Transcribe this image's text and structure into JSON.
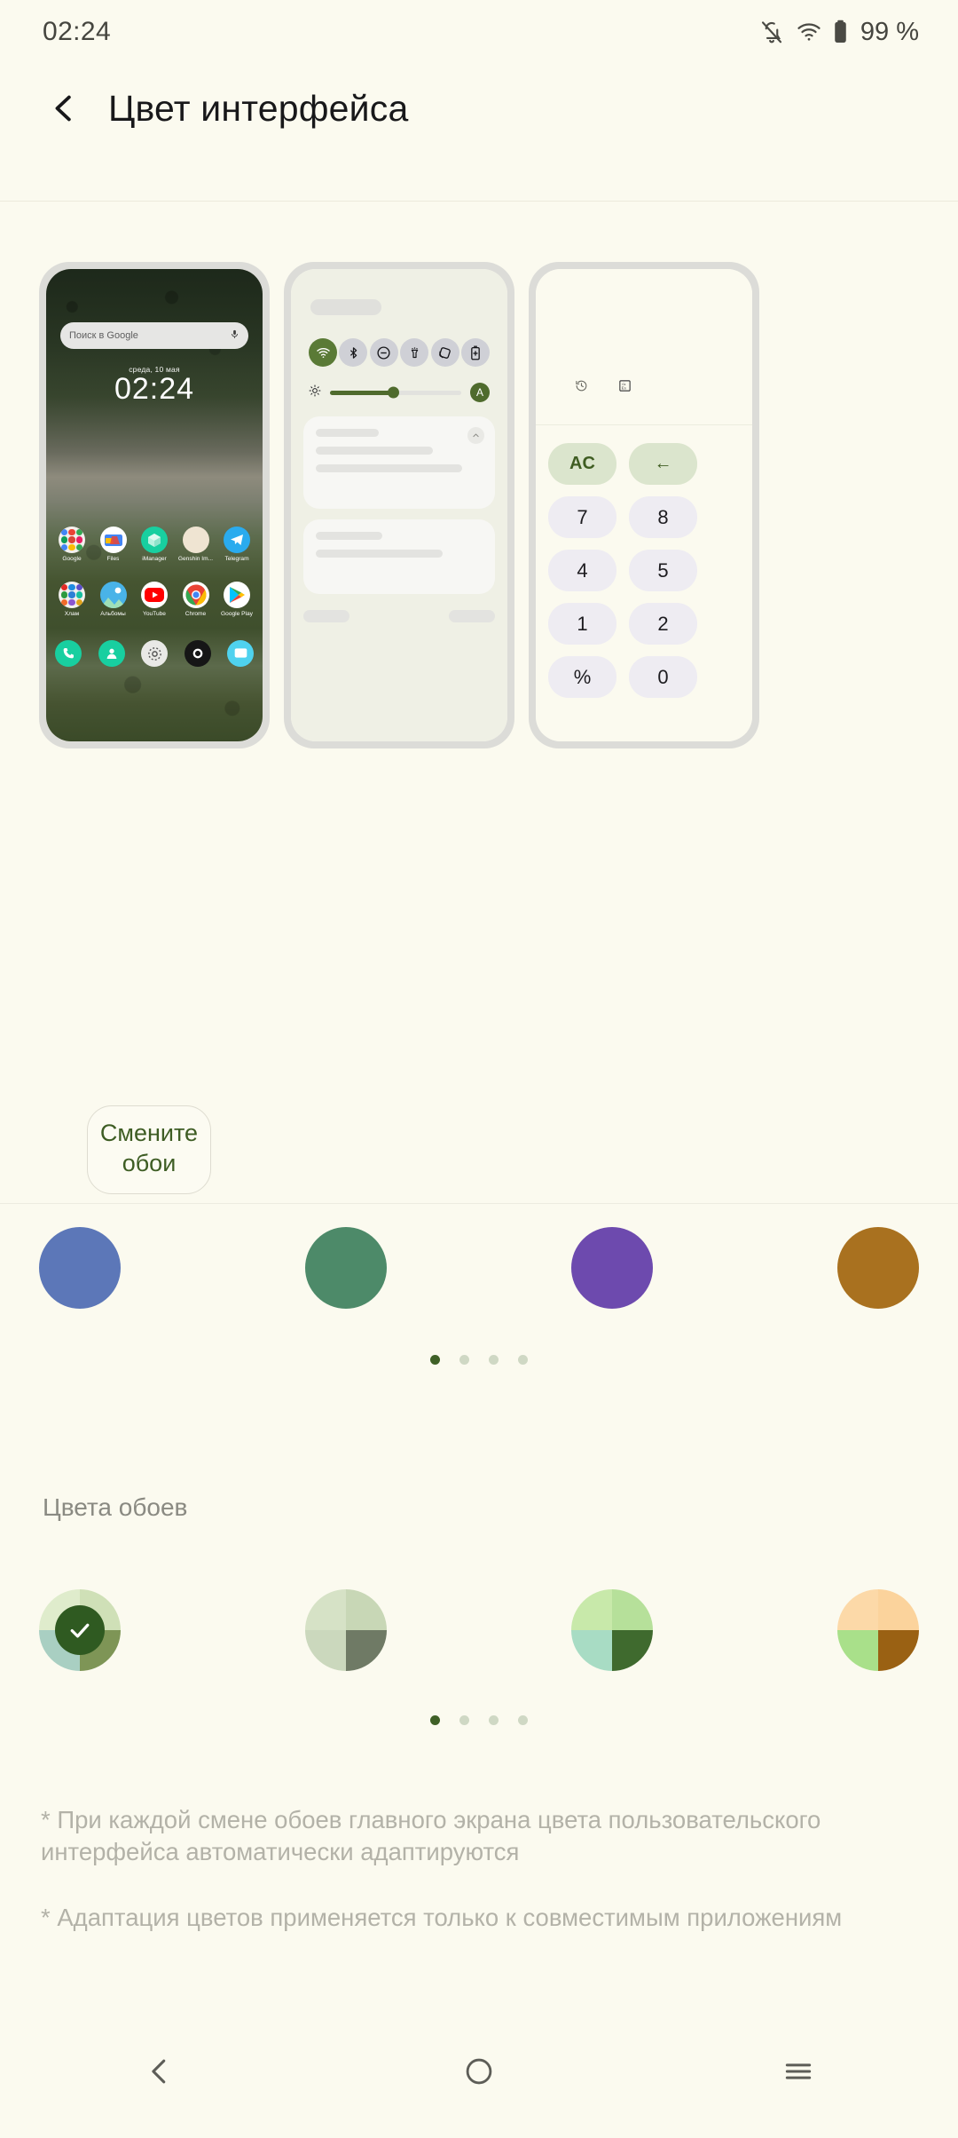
{
  "statusbar": {
    "time": "02:24",
    "battery_percent": "99 %",
    "icons": [
      "notifications-off-icon",
      "wifi-icon",
      "battery-icon"
    ]
  },
  "header": {
    "back_label": "back-chevron",
    "title": "Цвет интерфейса"
  },
  "preview": {
    "home_screen": {
      "search_placeholder": "Поиск в Google",
      "date": "среда, 10 мая",
      "time": "02:24",
      "apps_row1": [
        "Google",
        "Files",
        "iManager",
        "Genshin Im...",
        "Telegram"
      ],
      "apps_row2": [
        "Хлам",
        "Альбомы",
        "YouTube",
        "Chrome",
        "Google Play"
      ],
      "dock": [
        "phone-icon",
        "contacts-icon",
        "settings-icon",
        "camera-icon",
        "messages-icon"
      ]
    },
    "quick_settings": {
      "toggles": [
        "wifi-icon",
        "bluetooth-icon",
        "do-not-disturb-icon",
        "flashlight-icon",
        "auto-rotate-icon",
        "battery-saver-icon"
      ],
      "active_toggle": "wifi-icon",
      "brightness_icon": "brightness-icon",
      "brightness_value": 46,
      "auto_brightness_label": "A"
    },
    "calculator": {
      "tools": [
        "history-icon",
        "scientific-icon"
      ],
      "keys": [
        "AC",
        "←",
        "7",
        "8",
        "4",
        "5",
        "1",
        "2",
        "%",
        "0"
      ]
    }
  },
  "wallpaper_button": {
    "label": "Смените обои"
  },
  "accent_colors": {
    "swatches": [
      "#5c77b8",
      "#4d8a69",
      "#6d4aae",
      "#a9711f"
    ],
    "page_dots": 4,
    "active_dot": 0
  },
  "wallpaper_colors": {
    "title": "Цвета обоев",
    "selected_index": 0,
    "palettes": [
      {
        "tl": "#dfeccc",
        "tr": "#cfe0b7",
        "bl": "#a9cfc2",
        "br": "#7e9556"
      },
      {
        "tl": "#d6e2c6",
        "tr": "#c8d7b6",
        "bl": "#cbd8bd",
        "br": "#6f7a65"
      },
      {
        "tl": "#c8e9aa",
        "tr": "#b6e09a",
        "bl": "#a8dcc4",
        "br": "#3f6a2e"
      },
      {
        "tl": "#fcd9a8",
        "tr": "#fbd39c",
        "bl": "#a9e08a",
        "br": "#9a6113"
      }
    ],
    "page_dots": 4,
    "active_dot": 0
  },
  "footnotes": [
    "* При каждой смене обоев главного экрана цвета пользовательского интерфейса автоматически адаптируются",
    "* Адаптация цветов применяется только к совместимым приложениям"
  ],
  "navbar": {
    "items": [
      "back-icon",
      "home-icon",
      "recents-icon"
    ]
  },
  "theme": {
    "background": "#fbfaef",
    "accent": "#3f6026",
    "text": "#18181a",
    "muted": "#b3b2a8"
  }
}
